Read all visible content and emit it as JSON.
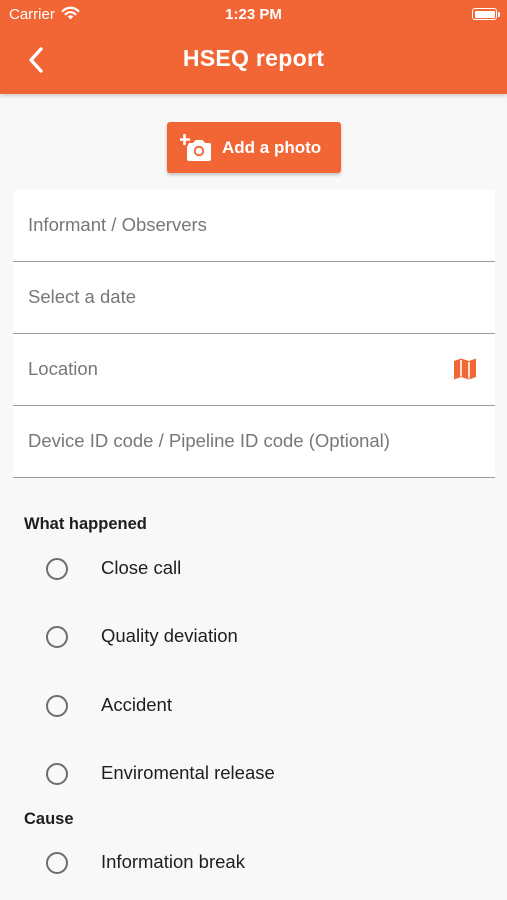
{
  "status_bar": {
    "carrier": "Carrier",
    "time": "1:23 PM"
  },
  "header": {
    "title": "HSEQ report",
    "back_icon": "chevron-left-icon"
  },
  "photo_button": {
    "label": "Add a photo",
    "icon": "add-camera-icon"
  },
  "form": {
    "informant_placeholder": "Informant / Observers",
    "date_placeholder": "Select a date",
    "location_placeholder": "Location",
    "location_icon": "map-icon",
    "device_placeholder": "Device ID code / Pipeline ID code (Optional)"
  },
  "what_happened": {
    "title": "What happened",
    "options": [
      "Close call",
      "Quality deviation",
      "Accident",
      "Enviromental release"
    ]
  },
  "cause": {
    "title": "Cause",
    "options": [
      "Information break"
    ]
  },
  "colors": {
    "accent": "#f26534",
    "background": "#f8f8f8",
    "divider": "#9e9e9e"
  }
}
